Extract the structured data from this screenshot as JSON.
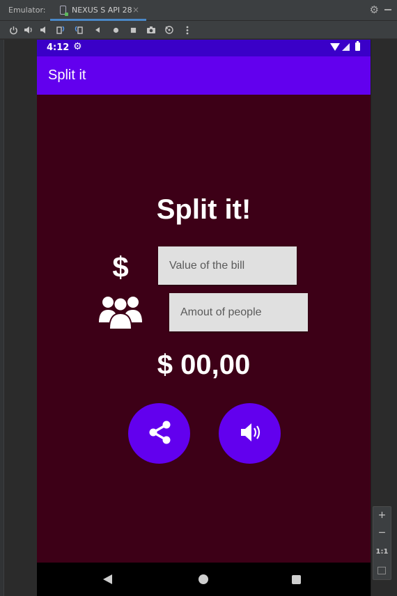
{
  "ide": {
    "label": "Emulator:",
    "tab_name": "NEXUS S API 28",
    "tab_close": "×",
    "settings_glyph": "⚙",
    "toolbar_icons": [
      "power-icon",
      "volume-up-icon",
      "volume-down-icon",
      "rotate-left-icon",
      "rotate-right-icon",
      "back-icon",
      "home-icon",
      "overview-icon",
      "screenshot-icon",
      "zoom-icon",
      "more-icon"
    ],
    "zoom": {
      "plus": "+",
      "minus": "−",
      "one_to_one": "1:1"
    }
  },
  "phone": {
    "status_time": "4:12",
    "status_gear": "⚙",
    "app_title": "Split it",
    "heading": "Split it!",
    "currency_symbol": "$",
    "bill_placeholder": "Value of the bill",
    "people_placeholder": "Amout of people",
    "total": "$ 00,00",
    "colors": {
      "status_bar": "#3a00c8",
      "app_bar": "#6200ee",
      "background": "#3d0017",
      "fab": "#6200ee"
    }
  }
}
